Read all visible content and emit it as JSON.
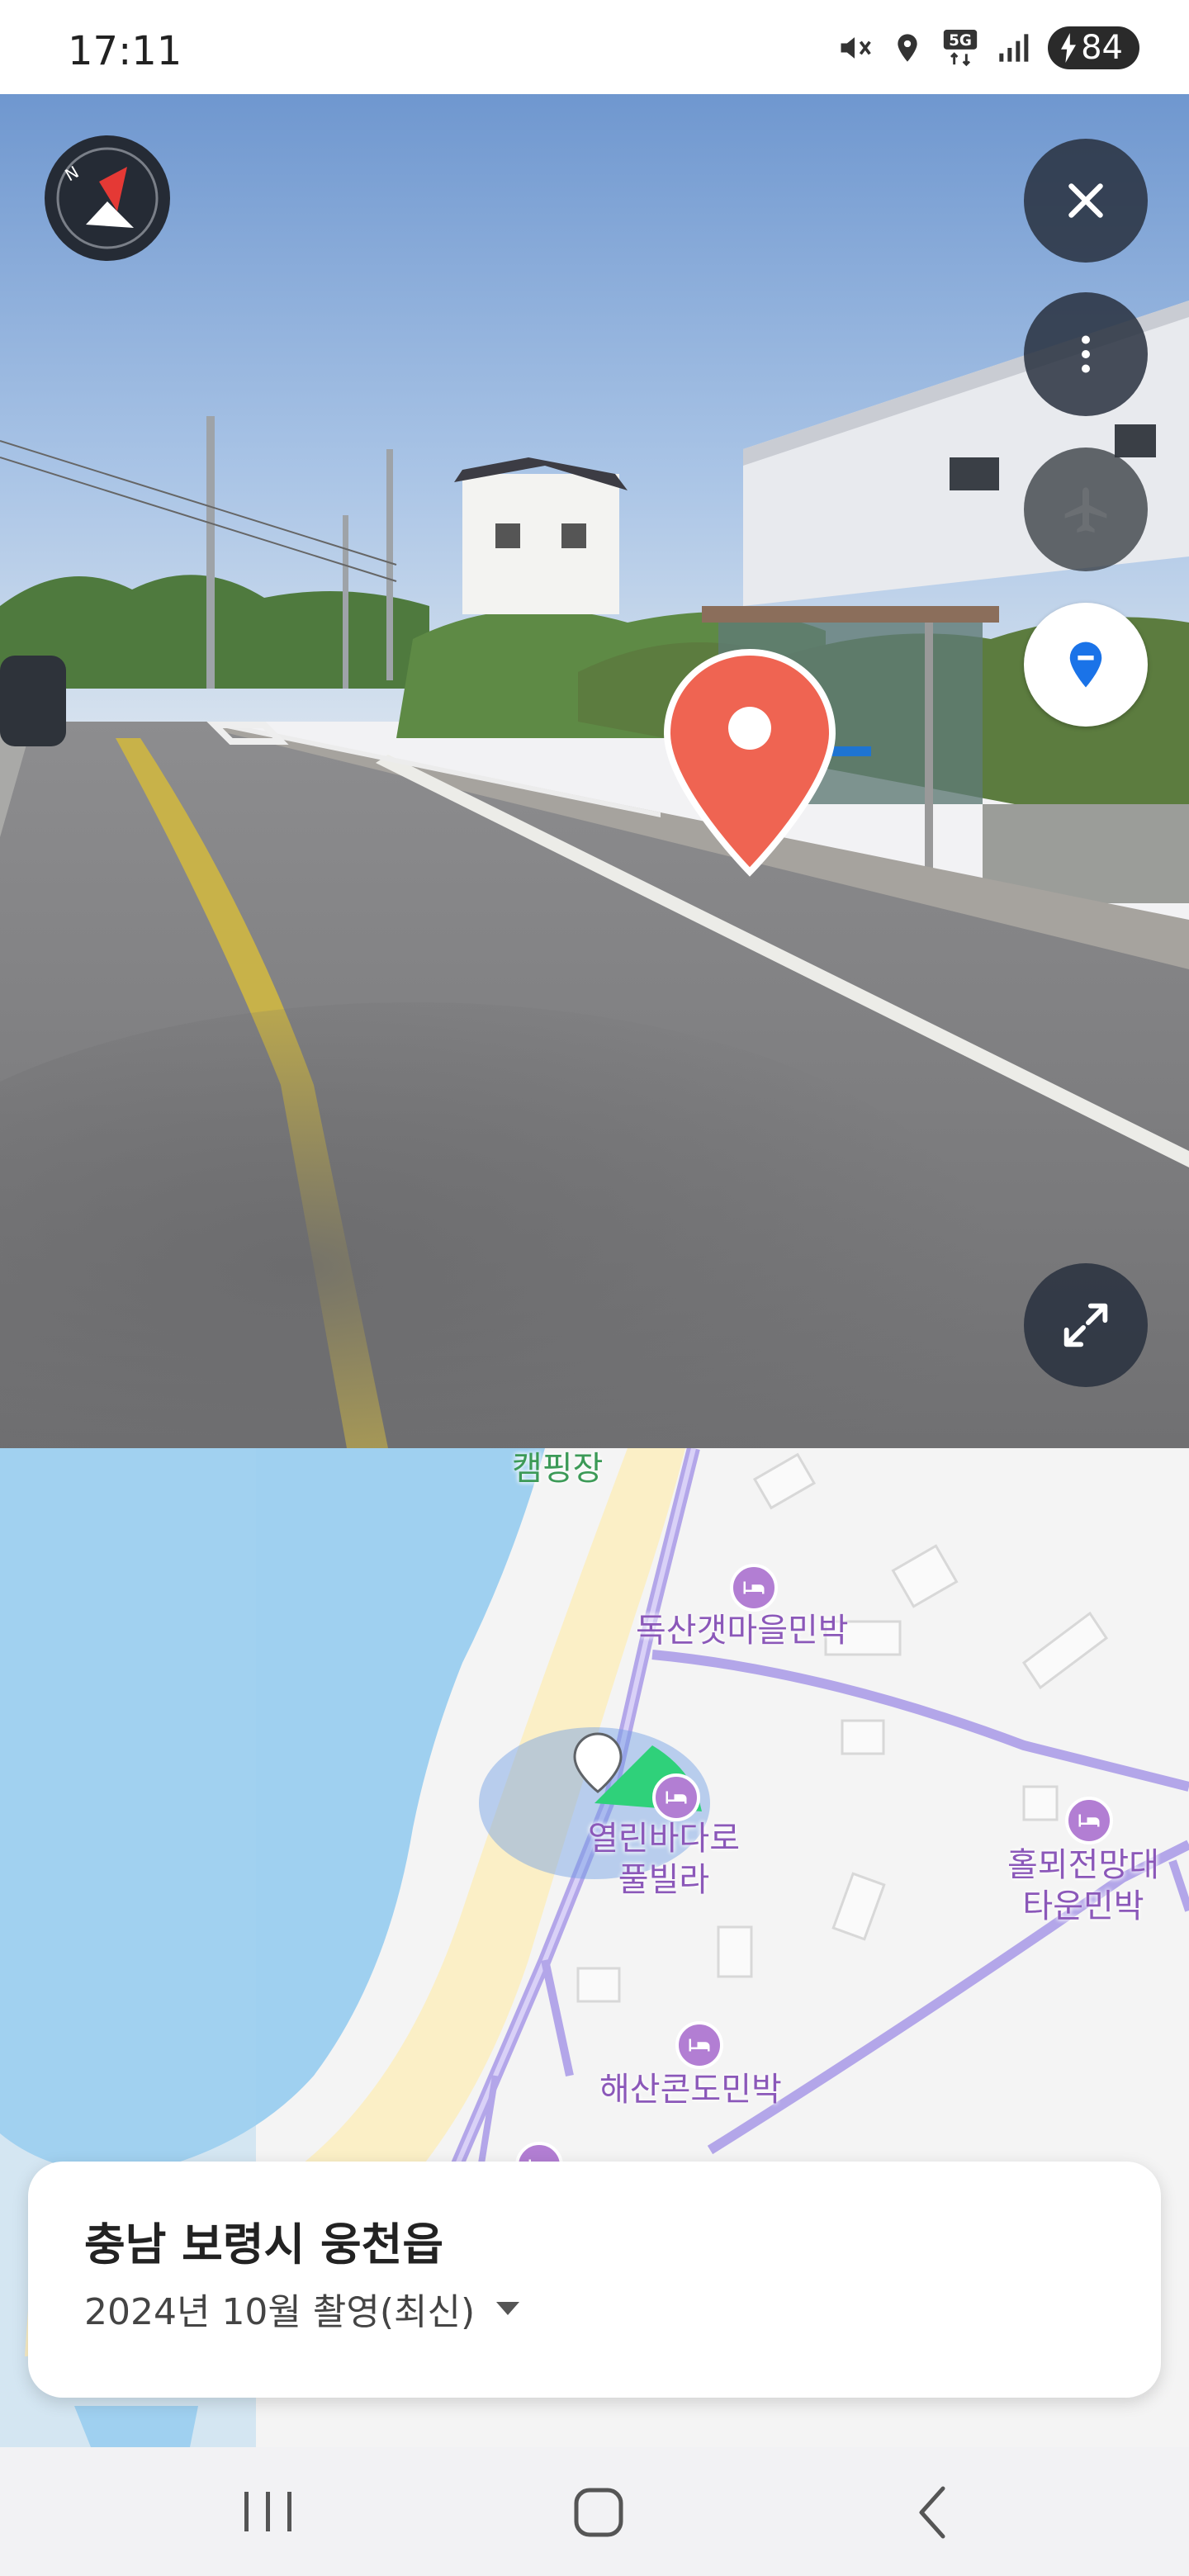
{
  "status_bar": {
    "time": "17:11",
    "icons": [
      "mute-icon",
      "location-icon",
      "5g-icon",
      "signal-icon"
    ],
    "battery_level": "84"
  },
  "street_view": {
    "buttons": [
      "compass-icon",
      "close-icon",
      "more-icon",
      "airplane-icon",
      "location-pin-icon",
      "expand-icon"
    ]
  },
  "map": {
    "labels": {
      "campsite": "캠핑장",
      "poi1": "독산갯마을민박",
      "poi2_line1": "열린바다로",
      "poi2_line2": "풀빌라",
      "poi3_line1": "홀뫼전망대",
      "poi3_line2": "타운민박",
      "poi4": "해산콘도민박"
    },
    "colors": {
      "water": "#9fd0f0",
      "sand": "#fbf0c8",
      "road": "#b3a6e9",
      "poi": "#8b58b9"
    }
  },
  "info_card": {
    "address": "충남 보령시 웅천읍",
    "date": "2024년 10월 촬영(최신)"
  },
  "nav": {
    "buttons": [
      "recent-apps-icon",
      "home-icon",
      "back-icon"
    ]
  }
}
